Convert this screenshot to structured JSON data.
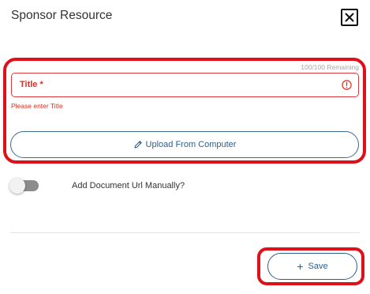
{
  "dialog": {
    "title": "Sponsor Resource"
  },
  "form": {
    "remaining": "100/100 Remaining",
    "title_label": "Title *",
    "title_error": "Please enter Title",
    "upload_label": "Upload From Computer",
    "toggle_label": "Add Document Url Manually?",
    "toggle_on": false
  },
  "footer": {
    "save_label": "Save"
  },
  "icons": {
    "close": "close-icon",
    "error": "error-icon",
    "pencil": "pencil-icon",
    "plus": "plus-icon"
  },
  "colors": {
    "accent": "#2e5f8c",
    "error": "#d93025",
    "annotation": "#e0101a"
  }
}
